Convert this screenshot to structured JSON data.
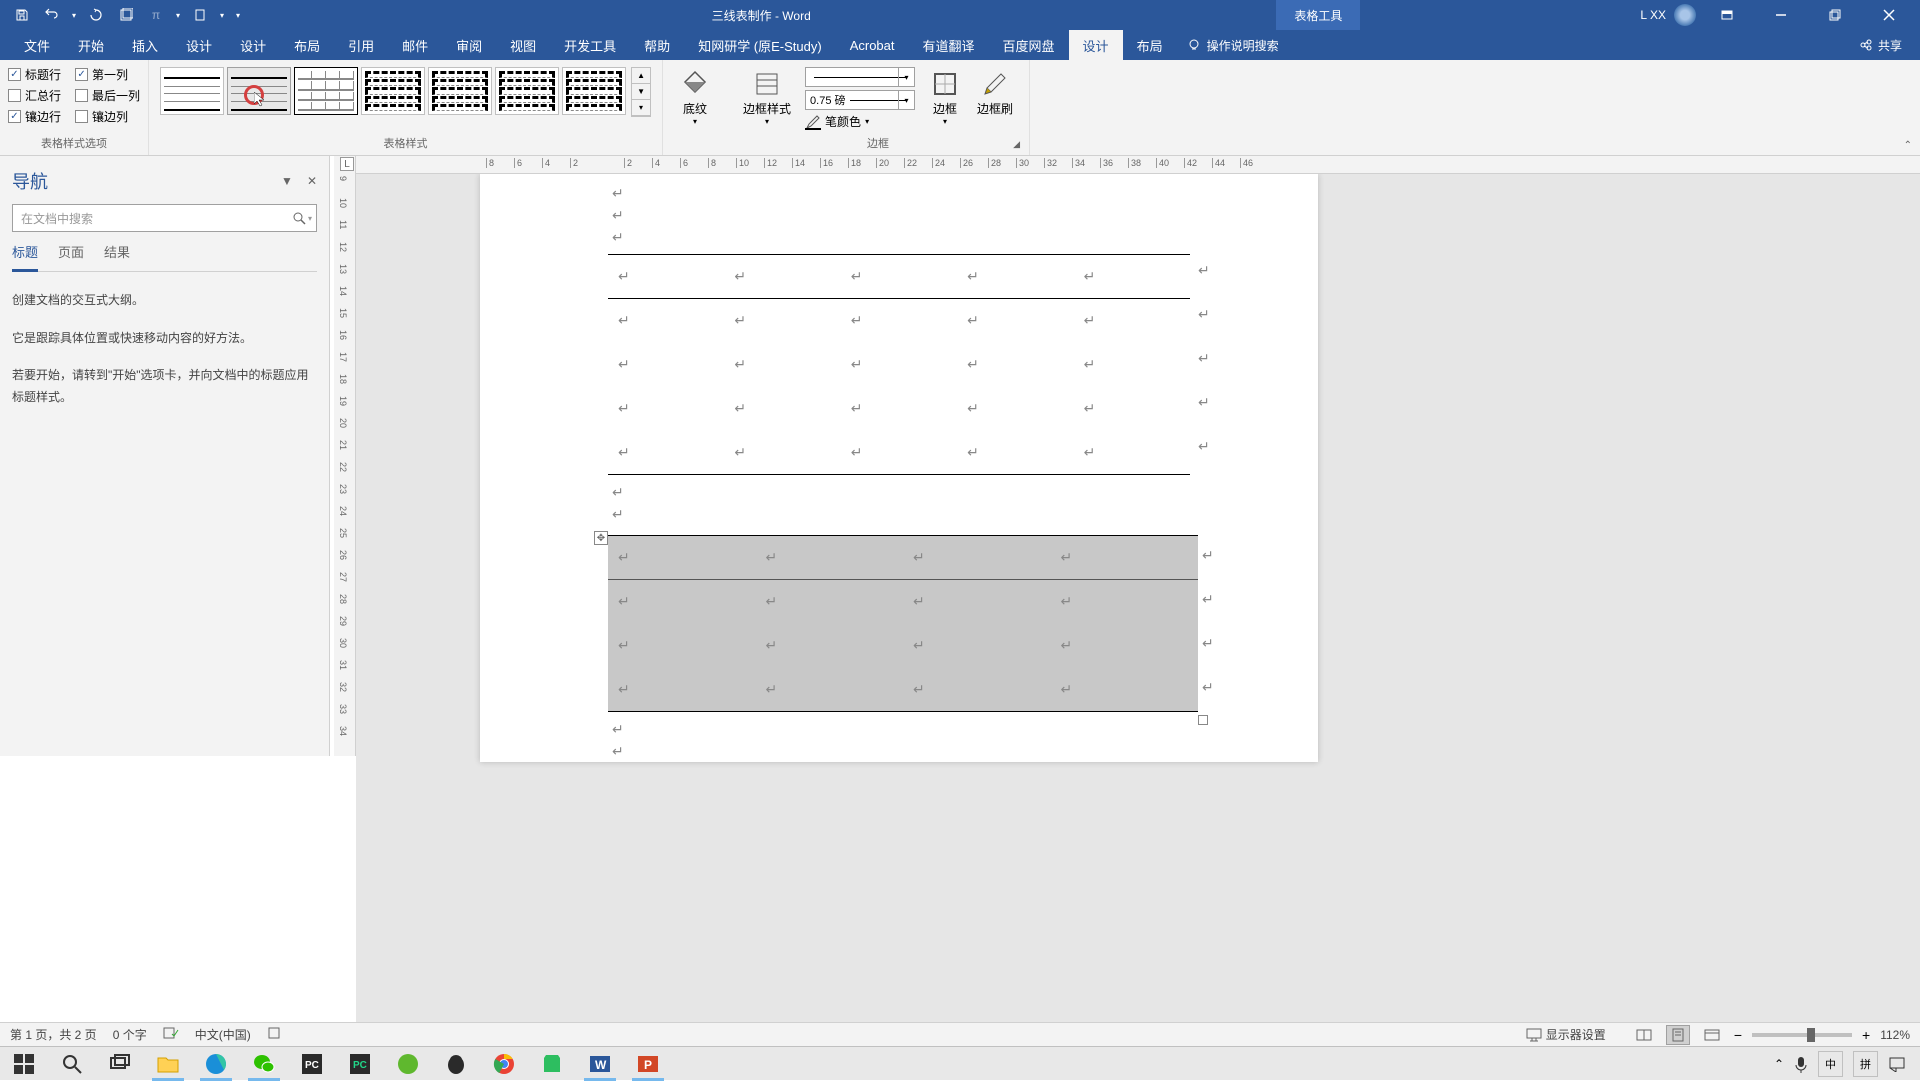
{
  "titlebar": {
    "doc_title": "三线表制作 - Word",
    "context_tab": "表格工具",
    "username": "L XX"
  },
  "tabs": {
    "file": "文件",
    "home": "开始",
    "insert": "插入",
    "design1": "设计",
    "design2": "设计",
    "layout1": "布局",
    "references": "引用",
    "mailings": "邮件",
    "review": "审阅",
    "view": "视图",
    "developer": "开发工具",
    "help": "帮助",
    "zhiwang": "知网研学 (原E-Study)",
    "acrobat": "Acrobat",
    "youdao": "有道翻译",
    "baidu": "百度网盘",
    "table_design": "设计",
    "table_layout": "布局",
    "tell_me": "操作说明搜索",
    "share": "共享"
  },
  "ribbon": {
    "style_options_label": "表格样式选项",
    "header_row": "标题行",
    "first_col": "第一列",
    "total_row": "汇总行",
    "last_col": "最后一列",
    "banded_row": "镶边行",
    "banded_col": "镶边列",
    "table_styles_label": "表格样式",
    "shading": "底纹",
    "border_style": "边框样式",
    "line_weight": "0.75 磅",
    "pen_color": "笔颜色",
    "border": "边框",
    "border_brush": "边框刷",
    "borders_label": "边框"
  },
  "nav": {
    "title": "导航",
    "search_placeholder": "在文档中搜索",
    "tab_headings": "标题",
    "tab_pages": "页面",
    "tab_results": "结果",
    "content_1": "创建文档的交互式大纲。",
    "content_2": "它是跟踪具体位置或快速移动内容的好方法。",
    "content_3": "若要开始，请转到\"开始\"选项卡，并向文档中的标题应用标题样式。"
  },
  "hruler_marks": [
    "8",
    "6",
    "4",
    "2",
    "2",
    "4",
    "6",
    "8",
    "10",
    "12",
    "14",
    "16",
    "18",
    "20",
    "22",
    "24",
    "26",
    "28",
    "30",
    "32",
    "34",
    "36",
    "38",
    "40",
    "42",
    "44",
    "46"
  ],
  "vruler_marks": [
    "9",
    "10",
    "11",
    "12",
    "13",
    "14",
    "15",
    "16",
    "17",
    "18",
    "19",
    "20",
    "21",
    "22",
    "23",
    "24",
    "25",
    "26",
    "27",
    "28",
    "29",
    "30",
    "31",
    "32",
    "33",
    "34"
  ],
  "status": {
    "page": "第 1 页，共 2 页",
    "words": "0 个字",
    "lang": "中文(中国)",
    "display_settings": "显示器设置",
    "zoom": "112%"
  },
  "tray": {
    "ime1": "中",
    "ime2": "拼"
  }
}
